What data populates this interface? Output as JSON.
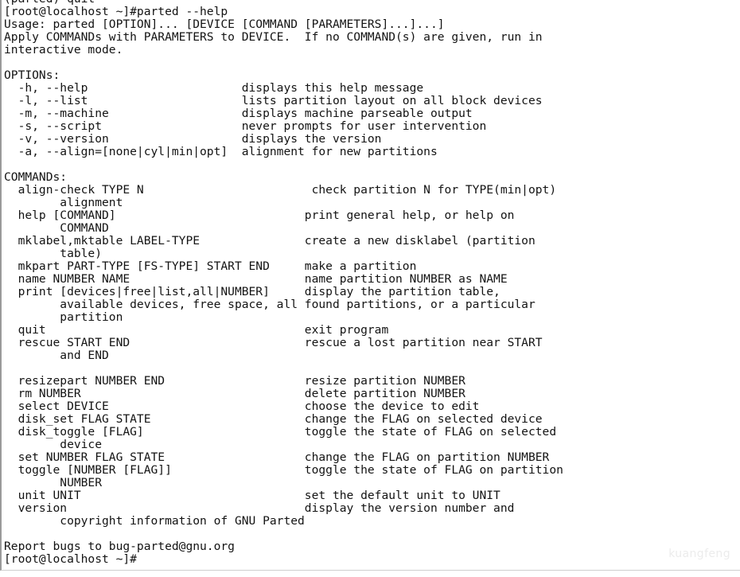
{
  "terminal": {
    "prompt_user_host": "[root@localhost ~]#",
    "command": "parted --help",
    "colors": {
      "background": "#ffffff",
      "foreground": "#131313",
      "border": "#9a9a9a",
      "watermark": "#ececec"
    },
    "watermark": "kuangfeng",
    "lines": [
      "(parted) quit",
      "[root@localhost ~]#parted --help",
      "Usage: parted [OPTION]... [DEVICE [COMMAND [PARAMETERS]...]...]",
      "Apply COMMANDs with PARAMETERS to DEVICE.  If no COMMAND(s) are given, run in",
      "interactive mode.",
      "",
      "OPTIONs:",
      "  -h, --help                      displays this help message",
      "  -l, --list                      lists partition layout on all block devices",
      "  -m, --machine                   displays machine parseable output",
      "  -s, --script                    never prompts for user intervention",
      "  -v, --version                   displays the version",
      "  -a, --align=[none|cyl|min|opt]  alignment for new partitions",
      "",
      "COMMANDs:",
      "  align-check TYPE N                        check partition N for TYPE(min|opt)",
      "        alignment",
      "  help [COMMAND]                           print general help, or help on",
      "        COMMAND",
      "  mklabel,mktable LABEL-TYPE               create a new disklabel (partition",
      "        table)",
      "  mkpart PART-TYPE [FS-TYPE] START END     make a partition",
      "  name NUMBER NAME                         name partition NUMBER as NAME",
      "  print [devices|free|list,all|NUMBER]     display the partition table,",
      "        available devices, free space, all found partitions, or a particular",
      "        partition",
      "  quit                                     exit program",
      "  rescue START END                         rescue a lost partition near START",
      "        and END",
      "",
      "  resizepart NUMBER END                    resize partition NUMBER",
      "  rm NUMBER                                delete partition NUMBER",
      "  select DEVICE                            choose the device to edit",
      "  disk_set FLAG STATE                      change the FLAG on selected device",
      "  disk_toggle [FLAG]                       toggle the state of FLAG on selected",
      "        device",
      "  set NUMBER FLAG STATE                    change the FLAG on partition NUMBER",
      "  toggle [NUMBER [FLAG]]                   toggle the state of FLAG on partition",
      "        NUMBER",
      "  unit UNIT                                set the default unit to UNIT",
      "  version                                  display the version number and",
      "        copyright information of GNU Parted",
      "",
      "Report bugs to bug-parted@gnu.org",
      "[root@localhost ~]#"
    ]
  }
}
